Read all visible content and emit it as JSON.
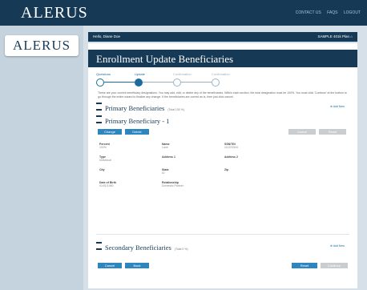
{
  "header": {
    "brand": "ALERUS",
    "links": [
      "CONTACT US",
      "FAQS",
      "LOGOUT"
    ]
  },
  "sidebar": {
    "logo": "ALERUS"
  },
  "greeting": {
    "hello": "Hello, Diane Doe",
    "plan": "SAMPLE 401k Plan"
  },
  "page_title": "Enrollment Update Beneficiaries",
  "steps": [
    "Questions",
    "Update",
    "Confirmation",
    "Confirmation"
  ],
  "intro_text": "These are your current beneficiary designations. You may add, edit, or delete any of the beneficiaries. Within each section, the total designation must be 100%. You must click 'Continue' at the bottom to go through the entire wizard to finalize any change. If the beneficiaries are correct as is, then just click cancel.",
  "primary": {
    "title": "Primary Beneficiaries",
    "subtitle": "(Total 100 %)",
    "add_new": "Add New",
    "beneficiary_title": "Primary Beneficiary - 1",
    "buttons": {
      "change": "Change",
      "delete": "Delete",
      "cancel": "Cancel",
      "reset": "Reset"
    },
    "fields": {
      "percent_label": "Percent",
      "percent_value": "100%",
      "name_label": "Name",
      "name_value": "Lane",
      "ssn_label": "SSN/TIN",
      "ssn_value": "111223344",
      "type_label": "Type",
      "type_value": "Individual",
      "address1_label": "Address 1",
      "address1_value": "",
      "address2_label": "Address 2",
      "address2_value": "",
      "city_label": "City",
      "city_value": "",
      "state_label": "State",
      "state_value": "ID",
      "zip_label": "Zip",
      "zip_value": "",
      "dob_label": "Date of Birth",
      "dob_value": "01/01/1980",
      "relationship_label": "Relationship",
      "relationship_value": "Domestic Partner"
    }
  },
  "secondary": {
    "title": "Secondary Beneficiaries",
    "subtitle": "(Total 0 %)",
    "add_new": "Add New"
  },
  "footer_buttons": {
    "cancel": "Cancel",
    "back": "Back",
    "reset": "Reset",
    "continue": "Continue"
  }
}
